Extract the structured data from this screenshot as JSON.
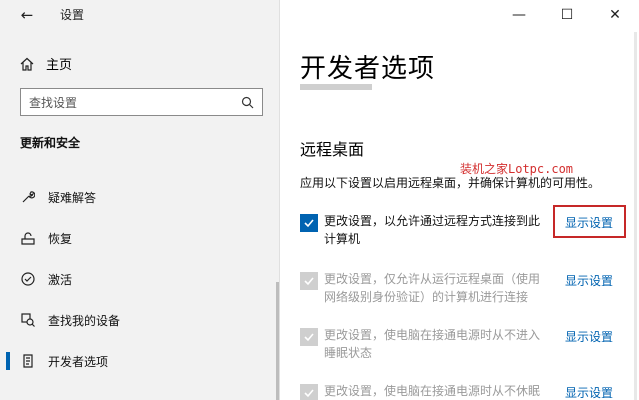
{
  "window": {
    "title": "设置",
    "minimize_glyph": "—",
    "maximize_glyph": "☐",
    "close_glyph": "✕"
  },
  "sidebar": {
    "home_label": "主页",
    "search_placeholder": "查找设置",
    "section_title": "更新和安全",
    "items": [
      {
        "label": "疑难解答",
        "icon": "wrench-icon"
      },
      {
        "label": "恢复",
        "icon": "recovery-icon"
      },
      {
        "label": "激活",
        "icon": "check-circle-icon"
      },
      {
        "label": "查找我的设备",
        "icon": "find-device-icon"
      },
      {
        "label": "开发者选项",
        "icon": "developer-icon",
        "active": true
      }
    ]
  },
  "main": {
    "page_title": "开发者选项",
    "group_title": "远程桌面",
    "watermark": "装机之家Lotpc.com",
    "description": "应用以下设置以启用远程桌面，并确保计算机的可用性。",
    "options": [
      {
        "text": "更改设置，以允许通过远程方式连接到此计算机",
        "link": "显示设置",
        "checked": true,
        "disabled": false
      },
      {
        "text": "更改设置，仅允许从运行远程桌面（使用网络级别身份验证）的计算机进行连接",
        "link": "显示设置",
        "checked": true,
        "disabled": true
      },
      {
        "text": "更改设置，使电脑在接通电源时从不进入睡眠状态",
        "link": "显示设置",
        "checked": true,
        "disabled": true
      },
      {
        "text": "更改设置，使电脑在接通电源时从不休眠",
        "link": "显示设置",
        "checked": true,
        "disabled": true
      }
    ]
  },
  "colors": {
    "accent": "#0063b1",
    "highlight": "#c62828",
    "sidebar_bg": "#f2f2f2"
  }
}
